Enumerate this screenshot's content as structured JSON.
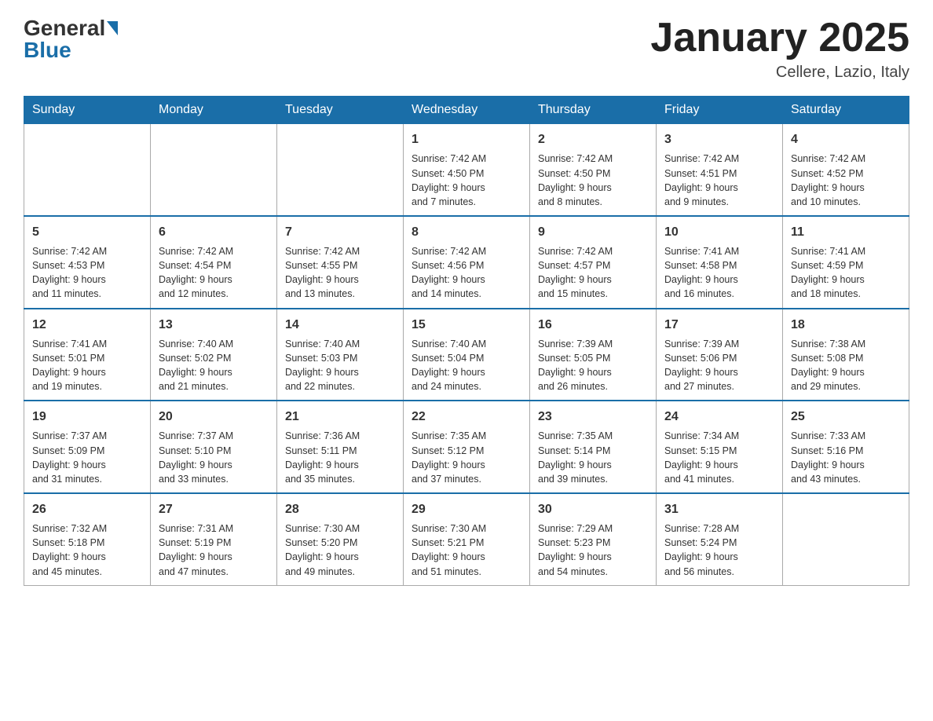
{
  "header": {
    "logo_general": "General",
    "logo_blue": "Blue",
    "title": "January 2025",
    "subtitle": "Cellere, Lazio, Italy"
  },
  "weekdays": [
    "Sunday",
    "Monday",
    "Tuesday",
    "Wednesday",
    "Thursday",
    "Friday",
    "Saturday"
  ],
  "weeks": [
    [
      {
        "day": "",
        "info": ""
      },
      {
        "day": "",
        "info": ""
      },
      {
        "day": "",
        "info": ""
      },
      {
        "day": "1",
        "info": "Sunrise: 7:42 AM\nSunset: 4:50 PM\nDaylight: 9 hours\nand 7 minutes."
      },
      {
        "day": "2",
        "info": "Sunrise: 7:42 AM\nSunset: 4:50 PM\nDaylight: 9 hours\nand 8 minutes."
      },
      {
        "day": "3",
        "info": "Sunrise: 7:42 AM\nSunset: 4:51 PM\nDaylight: 9 hours\nand 9 minutes."
      },
      {
        "day": "4",
        "info": "Sunrise: 7:42 AM\nSunset: 4:52 PM\nDaylight: 9 hours\nand 10 minutes."
      }
    ],
    [
      {
        "day": "5",
        "info": "Sunrise: 7:42 AM\nSunset: 4:53 PM\nDaylight: 9 hours\nand 11 minutes."
      },
      {
        "day": "6",
        "info": "Sunrise: 7:42 AM\nSunset: 4:54 PM\nDaylight: 9 hours\nand 12 minutes."
      },
      {
        "day": "7",
        "info": "Sunrise: 7:42 AM\nSunset: 4:55 PM\nDaylight: 9 hours\nand 13 minutes."
      },
      {
        "day": "8",
        "info": "Sunrise: 7:42 AM\nSunset: 4:56 PM\nDaylight: 9 hours\nand 14 minutes."
      },
      {
        "day": "9",
        "info": "Sunrise: 7:42 AM\nSunset: 4:57 PM\nDaylight: 9 hours\nand 15 minutes."
      },
      {
        "day": "10",
        "info": "Sunrise: 7:41 AM\nSunset: 4:58 PM\nDaylight: 9 hours\nand 16 minutes."
      },
      {
        "day": "11",
        "info": "Sunrise: 7:41 AM\nSunset: 4:59 PM\nDaylight: 9 hours\nand 18 minutes."
      }
    ],
    [
      {
        "day": "12",
        "info": "Sunrise: 7:41 AM\nSunset: 5:01 PM\nDaylight: 9 hours\nand 19 minutes."
      },
      {
        "day": "13",
        "info": "Sunrise: 7:40 AM\nSunset: 5:02 PM\nDaylight: 9 hours\nand 21 minutes."
      },
      {
        "day": "14",
        "info": "Sunrise: 7:40 AM\nSunset: 5:03 PM\nDaylight: 9 hours\nand 22 minutes."
      },
      {
        "day": "15",
        "info": "Sunrise: 7:40 AM\nSunset: 5:04 PM\nDaylight: 9 hours\nand 24 minutes."
      },
      {
        "day": "16",
        "info": "Sunrise: 7:39 AM\nSunset: 5:05 PM\nDaylight: 9 hours\nand 26 minutes."
      },
      {
        "day": "17",
        "info": "Sunrise: 7:39 AM\nSunset: 5:06 PM\nDaylight: 9 hours\nand 27 minutes."
      },
      {
        "day": "18",
        "info": "Sunrise: 7:38 AM\nSunset: 5:08 PM\nDaylight: 9 hours\nand 29 minutes."
      }
    ],
    [
      {
        "day": "19",
        "info": "Sunrise: 7:37 AM\nSunset: 5:09 PM\nDaylight: 9 hours\nand 31 minutes."
      },
      {
        "day": "20",
        "info": "Sunrise: 7:37 AM\nSunset: 5:10 PM\nDaylight: 9 hours\nand 33 minutes."
      },
      {
        "day": "21",
        "info": "Sunrise: 7:36 AM\nSunset: 5:11 PM\nDaylight: 9 hours\nand 35 minutes."
      },
      {
        "day": "22",
        "info": "Sunrise: 7:35 AM\nSunset: 5:12 PM\nDaylight: 9 hours\nand 37 minutes."
      },
      {
        "day": "23",
        "info": "Sunrise: 7:35 AM\nSunset: 5:14 PM\nDaylight: 9 hours\nand 39 minutes."
      },
      {
        "day": "24",
        "info": "Sunrise: 7:34 AM\nSunset: 5:15 PM\nDaylight: 9 hours\nand 41 minutes."
      },
      {
        "day": "25",
        "info": "Sunrise: 7:33 AM\nSunset: 5:16 PM\nDaylight: 9 hours\nand 43 minutes."
      }
    ],
    [
      {
        "day": "26",
        "info": "Sunrise: 7:32 AM\nSunset: 5:18 PM\nDaylight: 9 hours\nand 45 minutes."
      },
      {
        "day": "27",
        "info": "Sunrise: 7:31 AM\nSunset: 5:19 PM\nDaylight: 9 hours\nand 47 minutes."
      },
      {
        "day": "28",
        "info": "Sunrise: 7:30 AM\nSunset: 5:20 PM\nDaylight: 9 hours\nand 49 minutes."
      },
      {
        "day": "29",
        "info": "Sunrise: 7:30 AM\nSunset: 5:21 PM\nDaylight: 9 hours\nand 51 minutes."
      },
      {
        "day": "30",
        "info": "Sunrise: 7:29 AM\nSunset: 5:23 PM\nDaylight: 9 hours\nand 54 minutes."
      },
      {
        "day": "31",
        "info": "Sunrise: 7:28 AM\nSunset: 5:24 PM\nDaylight: 9 hours\nand 56 minutes."
      },
      {
        "day": "",
        "info": ""
      }
    ]
  ]
}
